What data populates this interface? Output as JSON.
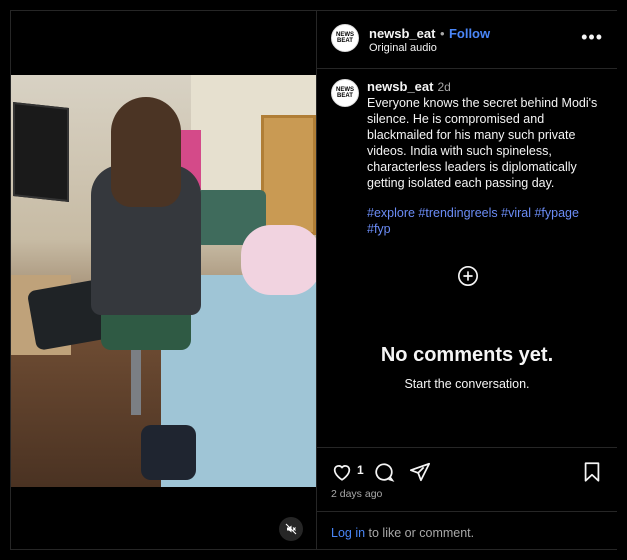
{
  "post": {
    "username": "newsb_eat",
    "separator": "•",
    "follow_label": "Follow",
    "audio": "Original audio",
    "more_label": "•••",
    "avatar_text": "NEWS BEAT"
  },
  "caption": {
    "username": "newsb_eat",
    "time": "2d",
    "text": "Everyone knows the secret behind Modi's silence. He is compromised and blackmailed for his many such private videos. India with such spineless, characterless leaders is diplomatically getting isolated each passing day.",
    "hashtags_line1": "#explore #trendingreels #viral #fypage",
    "hashtags_line2": "#fyp"
  },
  "comments": {
    "empty_title": "No comments yet.",
    "empty_sub": "Start the conversation."
  },
  "actions": {
    "like_count": "1",
    "posted": "2 days ago",
    "login_link": "Log in",
    "login_rest": " to like or comment."
  },
  "icons": [
    "heart-icon",
    "comment-icon",
    "share-icon",
    "bookmark-icon",
    "add-comment-icon",
    "mute-icon",
    "more-icon"
  ]
}
